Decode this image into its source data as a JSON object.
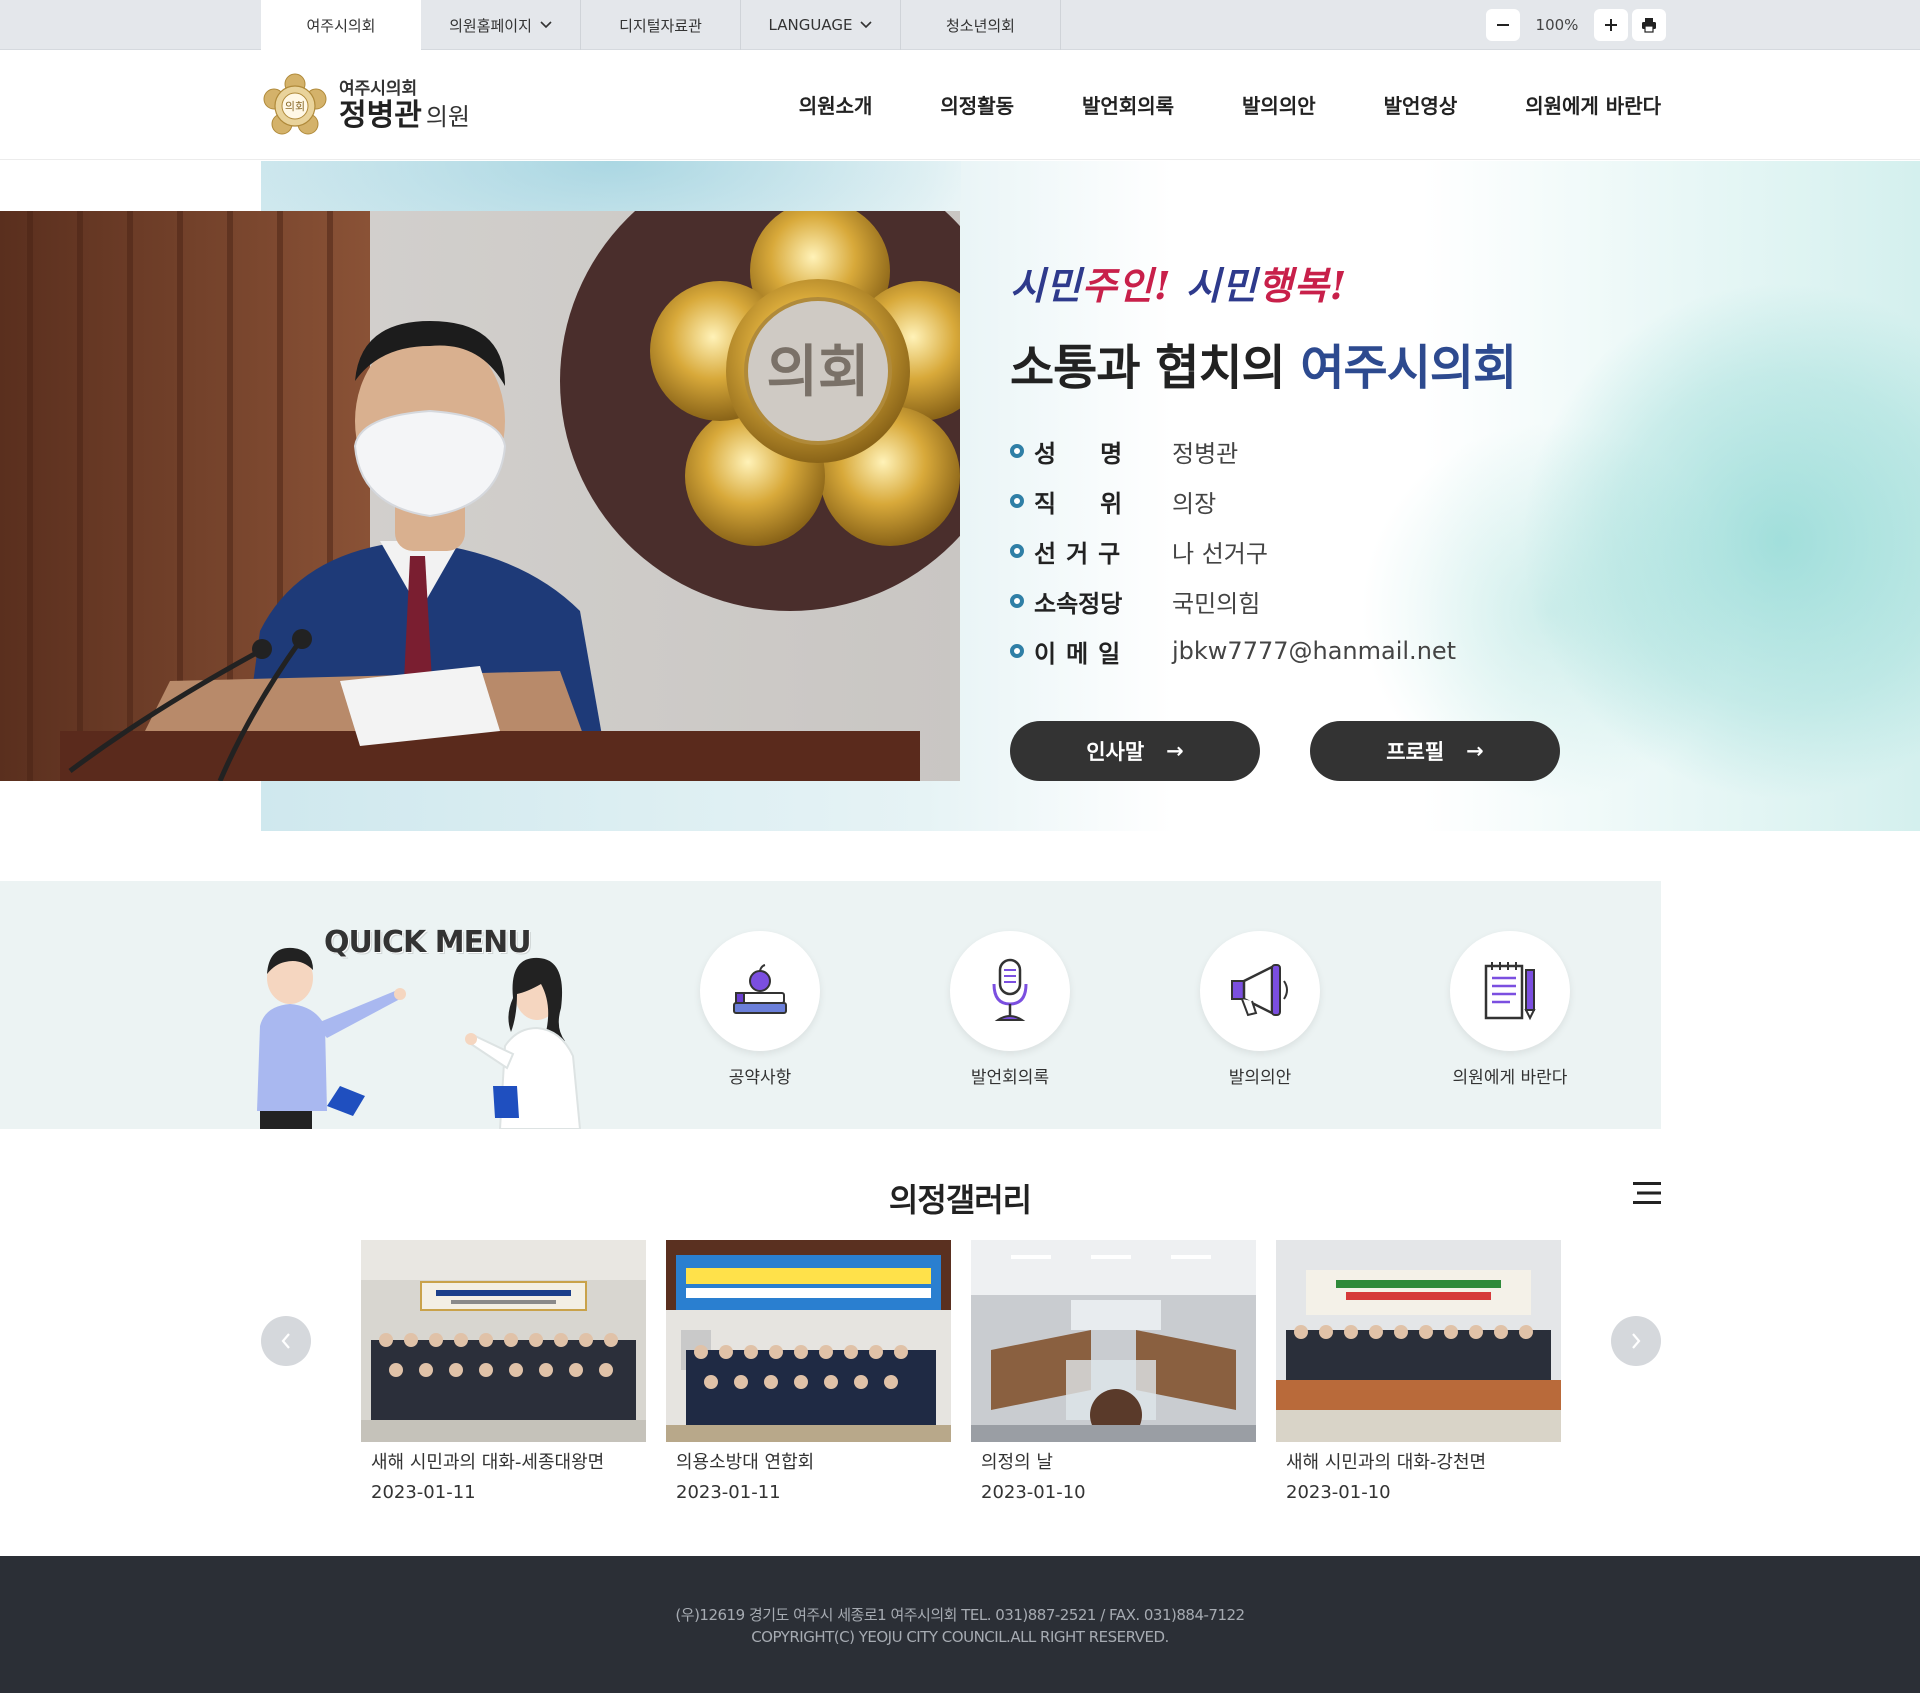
{
  "util": {
    "tabs": [
      {
        "label": "여주시의회",
        "has_dropdown": false
      },
      {
        "label": "의원홈페이지",
        "has_dropdown": true
      },
      {
        "label": "디지털자료관",
        "has_dropdown": false
      },
      {
        "label": "LANGUAGE",
        "has_dropdown": true
      },
      {
        "label": "청소년의회",
        "has_dropdown": false
      }
    ],
    "zoom_level": "100%",
    "icons": [
      "zoom-out-icon",
      "zoom-in-icon",
      "print-icon"
    ]
  },
  "header": {
    "logo_sub": "여주시의회",
    "logo_name": "정병관",
    "logo_suffix": "의원",
    "emblem_text": "의회",
    "nav": [
      "의원소개",
      "의정활동",
      "발언회의록",
      "발의의안",
      "발언영상",
      "의원에게 바란다"
    ]
  },
  "hero": {
    "photo_emblem_text": "의회",
    "slogan_part1": "시민",
    "slogan_part2": "주인!",
    "slogan_part3": " 시민",
    "slogan_part4": "행복!",
    "title_prefix": "소통과 협치의 ",
    "title_accent": "여주시의회",
    "info": [
      {
        "label": "성명",
        "value": "정병관"
      },
      {
        "label": "직위",
        "value": "의장"
      },
      {
        "label": "선거구",
        "value": "나 선거구"
      },
      {
        "label": "소속정당",
        "value": "국민의힘"
      },
      {
        "label": "이메일",
        "value": "jbkw7777@hanmail.net"
      }
    ],
    "buttons": [
      {
        "label": "인사말",
        "arrow": "→"
      },
      {
        "label": "프로필",
        "arrow": "→"
      }
    ],
    "colors": {
      "accent": "#2d4a8f",
      "slogan_red": "#c8204a",
      "button_bg": "#333333"
    }
  },
  "quick_menu": {
    "title": "QUICK MENU",
    "items": [
      {
        "label": "공약사항",
        "icon": "books-apple-icon"
      },
      {
        "label": "발언회의록",
        "icon": "microphone-icon"
      },
      {
        "label": "발의의안",
        "icon": "megaphone-icon"
      },
      {
        "label": "의원에게 바란다",
        "icon": "notepad-pen-icon"
      }
    ]
  },
  "gallery": {
    "title": "의정갤러리",
    "items": [
      {
        "caption": "새해 시민과의 대화-세종대왕면",
        "date": "2023-01-11"
      },
      {
        "caption": "의용소방대 연합회",
        "date": "2023-01-11"
      },
      {
        "caption": "의정의 날",
        "date": "2023-01-10"
      },
      {
        "caption": "새해 시민과의 대화-강천면",
        "date": "2023-01-10"
      }
    ],
    "prev_label": "‹",
    "next_label": "›"
  },
  "footer": {
    "address": "(우)12619 경기도 여주시 세종로1 여주시의회 TEL. 031)887-2521 / FAX. 031)884-7122",
    "copyright": "COPYRIGHT(C) YEOJU CITY COUNCIL.ALL RIGHT RESERVED."
  }
}
